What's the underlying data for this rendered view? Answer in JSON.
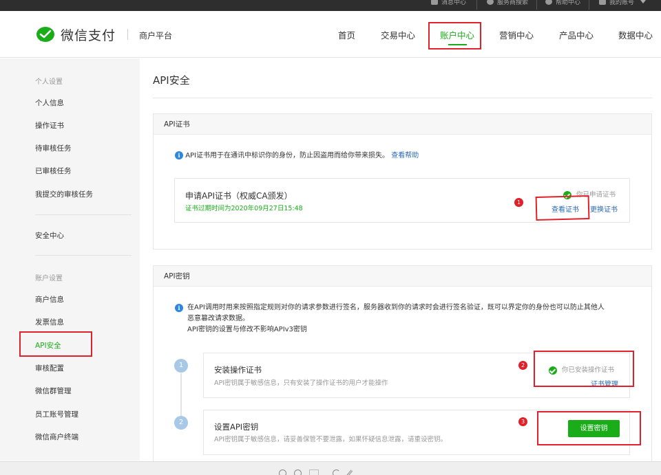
{
  "topbar": {
    "items": [
      "消息中心",
      "服务商搜索",
      "帮助中心",
      "我的账号"
    ],
    "icons": [
      "mail-icon",
      "search-icon",
      "help-icon",
      "user-icon"
    ]
  },
  "header": {
    "logo_text": "微信支付",
    "platform": "商户平台",
    "nav": [
      "首页",
      "交易中心",
      "账户中心",
      "营销中心",
      "产品中心",
      "数据中心"
    ],
    "active_nav": "账户中心",
    "accent_color": "#1aad19"
  },
  "sidebar": {
    "group1": "个人设置",
    "group1_items": [
      "个人信息",
      "操作证书",
      "待审核任务",
      "已审核任务",
      "我提交的审核任务"
    ],
    "security": "安全中心",
    "group2": "账户设置",
    "group2_items": [
      "商户信息",
      "发票信息",
      "API安全",
      "审核配置",
      "微信群管理",
      "员工账号管理",
      "微信商户终端"
    ]
  },
  "main": {
    "title": "API安全",
    "cert_panel": {
      "heading": "API证书",
      "tip": "API证书用于在通讯中标识你的身份，防止因盗用而给你带来损失。",
      "tip_link": "查看帮助",
      "box_title": "申请API证书（权威CA颁发）",
      "expire": "证书过期时间为2020年09月27日15:48",
      "status": "你已申请证书",
      "view_link": "查看证书",
      "replace_link": "更换证书"
    },
    "key_panel": {
      "heading": "API密钥",
      "tip_line1": "在API调用时用来按照指定规则对你的请求参数进行签名，服务器收到你的请求时会进行签名验证，既可以界定你的身份也可以防止其他人",
      "tip_line2": "恶意篡改请求数据。",
      "tip_line3": "API密钥的设置与修改不影响APIv3密钥",
      "steps": [
        {
          "num": "1",
          "title": "安装操作证书",
          "desc": "API密钥属于敏感信息，只有安装了操作证书的用户才能操作",
          "status": "你已安装操作证书",
          "link": "证书管理"
        },
        {
          "num": "2",
          "title": "设置API密钥",
          "desc": "API密钥属于敏感信息，请妥善保管不要泄露，如果怀疑信息泄露，请重设密钥。",
          "button": "设置密钥"
        }
      ]
    }
  },
  "annotations": {
    "markers": [
      "1",
      "2",
      "3"
    ],
    "color": "#e0202a"
  }
}
